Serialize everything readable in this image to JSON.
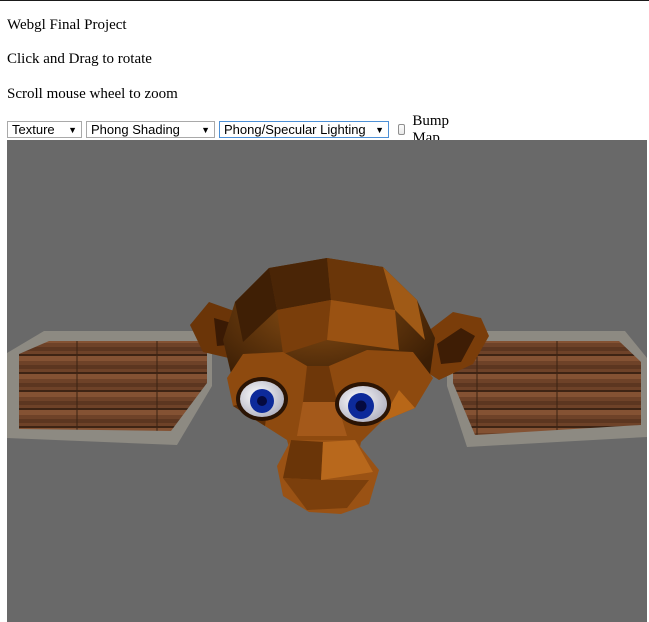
{
  "page": {
    "title": "Webgl Final Project",
    "instruction_rotate": "Click and Drag to rotate",
    "instruction_zoom": "Scroll mouse wheel to zoom"
  },
  "controls": {
    "texture_select": {
      "selected": "Texture"
    },
    "shading_select": {
      "selected": "Phong Shading"
    },
    "lighting_select": {
      "selected": "Phong/Specular Lighting"
    },
    "bump_map": {
      "label": "Bump Map",
      "checked": false
    }
  },
  "viewport": {
    "background_color": "#696969",
    "scene": [
      "wooden-plane-left",
      "monkey-head",
      "wooden-plane-right"
    ]
  },
  "icons": {
    "dropdown": "chevron-down-icon"
  }
}
